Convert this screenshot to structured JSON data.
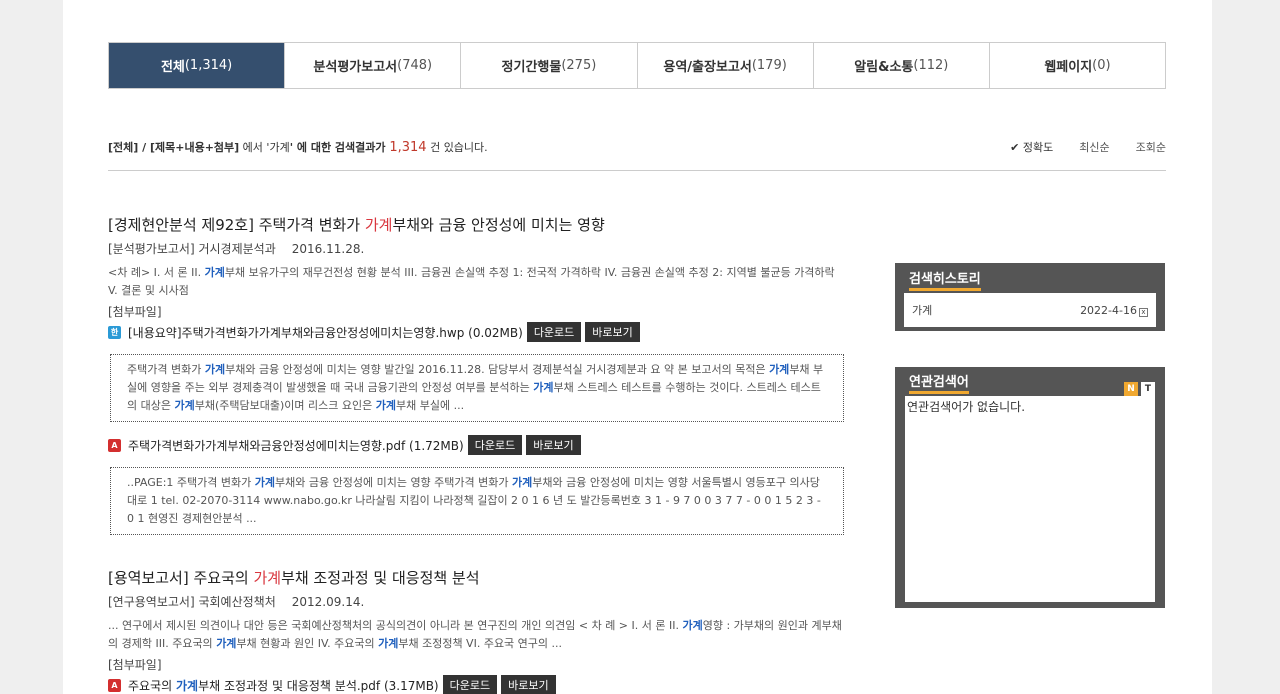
{
  "tabs": [
    {
      "label": "전체",
      "count": "(1,314)"
    },
    {
      "label": "분석평가보고서",
      "count": "(748)"
    },
    {
      "label": "정기간행물",
      "count": "(275)"
    },
    {
      "label": "용역/출장보고서",
      "count": "(179)"
    },
    {
      "label": "알림&소통",
      "count": "(112)"
    },
    {
      "label": "웹페이지",
      "count": "(0)"
    }
  ],
  "summary": {
    "scope": "[전체] / [제목+내용+첨부]",
    "mid": " 에서 '",
    "keyword": "가계",
    "mid2": "' 에 대한 검색결과가 ",
    "total": "1,314",
    "tail": " 건 있습니다."
  },
  "sort": {
    "accuracy": "✔ 정확도",
    "latest": "최신순",
    "views": "조회순"
  },
  "results": [
    {
      "title_pre": "[경제현안분석 제92호] 주택가격 변화가 ",
      "title_hl": "가계",
      "title_post": "부채와 금융 안정성에 미치는 영향",
      "category": "[분석평가보고서] 거시경제분석과",
      "date": "2016.11.28.",
      "body": [
        {
          "t": "<차 례> I. 서 론 II. "
        },
        {
          "t": "가계",
          "h": true
        },
        {
          "t": "부채 보유가구의 재무건전성 현황 분석 III. 금융권 손실액 추정 1: 전국적 가격하락 IV. 금융권 손실액 추정 2: 지역별 불균등 가격하락 V. 결론 및 시사점"
        }
      ],
      "attach_label": "[첨부파일]",
      "files": [
        {
          "icon": "hwp-file-icon",
          "icon_glyph": "한",
          "name": [
            {
              "t": "[내용요약]주택가격변화가"
            },
            {
              "t": "가계",
              "b": true
            },
            {
              "t": "부채와금융안정성에미치는영향.hwp (0.02MB)"
            }
          ],
          "download": "다운로드",
          "view": "바로보기",
          "preview": [
            {
              "t": "주택가격 변화가 "
            },
            {
              "t": "가계",
              "h": true
            },
            {
              "t": "부채와 금융 안정성에 미치는 영향 발간일 2016.11.28. 담당부서 경제분석실 거시경제분과 요 약 본 보고서의 목적은 "
            },
            {
              "t": "가계",
              "h": true
            },
            {
              "t": "부채 부실에 영향을 주는 외부 경제충격이 발생했을 때 국내 금융기관의 안정성 여부를 분석하는 "
            },
            {
              "t": "가계",
              "h": true
            },
            {
              "t": "부채 스트레스 테스트를 수행하는 것이다. 스트레스 테스트의 대상은 "
            },
            {
              "t": "가계",
              "h": true
            },
            {
              "t": "부채(주택담보대출)이며 리스크 요인은 "
            },
            {
              "t": "가계",
              "h": true
            },
            {
              "t": "부채 부실에 ..."
            }
          ]
        },
        {
          "icon": "pdf-file-icon",
          "icon_glyph": "A",
          "name": [
            {
              "t": "주택가격변화가"
            },
            {
              "t": "가계",
              "b": true
            },
            {
              "t": "부채와금융안정성에미치는영향.pdf (1.72MB)"
            }
          ],
          "download": "다운로드",
          "view": "바로보기",
          "preview": [
            {
              "t": "..PAGE:1 주택가격 변화가 "
            },
            {
              "t": "가계",
              "h": true
            },
            {
              "t": "부채와 금융 안정성에 미치는 영향 주택가격 변화가 "
            },
            {
              "t": "가계",
              "h": true
            },
            {
              "t": "부채와 금융 안정성에 미치는 영향 서울특별시 영등포구 의사당대로 1 tel. 02-2070-3114 www.nabo.go.kr 나라살림 지킴이 나라정책 길잡이 2 0 1 6 년 도 발간등록번호 3 1 - 9 7 0 0 3 7 7 - 0 0 1 5 2 3 - 0 1 현영진 경제현안분석 ..."
            }
          ]
        }
      ]
    },
    {
      "title_pre": "[용역보고서] 주요국의 ",
      "title_hl": "가계",
      "title_post": "부채 조정과정 및 대응정책 분석",
      "category": "[연구용역보고서] 국회예산정책처",
      "date": "2012.09.14.",
      "body": [
        {
          "t": "... 연구에서 제시된 의견이나 대안 등은 국회예산정책처의 공식의견이 아니라 본 연구진의 개인 의견임 < 차 례 > I. 서 론 II. "
        },
        {
          "t": "가계",
          "h": true
        },
        {
          "t": "영향 : 가부채의 원인과 계부채의 경제학 III. 주요국의 "
        },
        {
          "t": "가계",
          "h": true
        },
        {
          "t": "부채 현황과 원인 IV. 주요국의 "
        },
        {
          "t": "가계",
          "h": true
        },
        {
          "t": "부채 조정정책 VI. 주요국 연구의 ..."
        }
      ],
      "attach_label": "[첨부파일]",
      "files": [
        {
          "icon": "pdf-file-icon",
          "icon_glyph": "A",
          "name": [
            {
              "t": "주요국의 "
            },
            {
              "t": "가계",
              "h": true
            },
            {
              "t": "부채 조정과정 및 대응정책 분석.pdf (3.17MB)"
            }
          ],
          "download": "다운로드",
          "view": "바로보기"
        }
      ]
    }
  ],
  "history": {
    "title": "검색히스토리",
    "items": [
      {
        "term": "가계",
        "date": "2022-4-16",
        "remove": "x"
      }
    ]
  },
  "related": {
    "title": "연관검색어",
    "badge_n": "N",
    "badge_t": "T",
    "empty": "연관검색어가 없습니다."
  }
}
